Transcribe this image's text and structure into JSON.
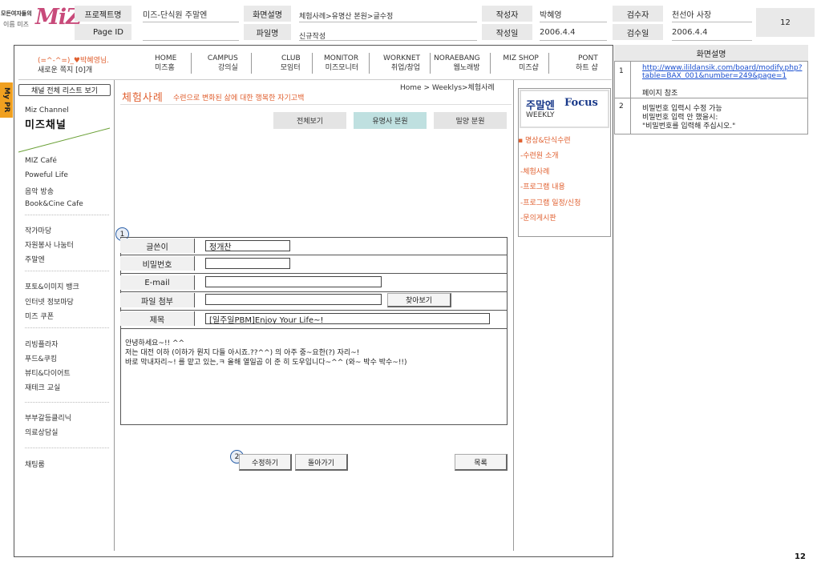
{
  "logo": {
    "line1": "모든여자들의",
    "line2": "이름 미즈",
    "mark": "MiZ"
  },
  "header": {
    "project_label": "프로젝트명",
    "project_value": "미즈-단식원 주말엔",
    "pageid_label": "Page ID",
    "pageid_value": "",
    "screen_label": "화면설명",
    "screen_value": "체험사례>유명산 본원>글수정",
    "file_label": "파일명",
    "file_value": "신규작성",
    "author_label": "작성자",
    "author_value": "박혜영",
    "date_label": "작성일",
    "date_value": "2006.4.4",
    "reviewer_label": "검수자",
    "reviewer_value": "천선아 사장",
    "review_date_label": "검수일",
    "review_date_value": "2006.4.4",
    "page_number": "12"
  },
  "user": {
    "greeting": "(=^-^=)_♥박혜영님.",
    "messages": "새로운 쪽지 [0]개"
  },
  "nav": [
    {
      "l1": "HOME",
      "l2": "미즈홈"
    },
    {
      "l1": "CAMPUS",
      "l2": "강의실"
    },
    {
      "l1": "CLUB",
      "l2": "모임터"
    },
    {
      "l1": "MONITOR",
      "l2": "미즈모니터"
    },
    {
      "l1": "WORKNET",
      "l2": "취업/창업"
    },
    {
      "l1": "NORAEBANG",
      "l2": "웹노래방"
    },
    {
      "l1": "MIZ SHOP",
      "l2": "미즈샵"
    },
    {
      "l1": "PONT",
      "l2": "하트 샵"
    }
  ],
  "mypr": "My PR",
  "sidebar": {
    "channel_list_btn": "채널 전체 리스트 보기",
    "channel_small": "Miz Channel",
    "channel_big": "미즈채널",
    "groups": [
      [
        "MIZ Café",
        "Poweful Life",
        "음악 방송",
        "Book&Cine Cafe"
      ],
      [
        "작가마당",
        "자원봉사 나눔터",
        "주말엔"
      ],
      [
        "포토&이미지 뱅크",
        "인터넷 정보마당",
        "미즈 쿠폰"
      ],
      [
        "리빙플라자",
        "푸드&쿠킹",
        "뷰티&다이어트",
        "재테크 교실"
      ],
      [
        "부부갈등클리닉",
        "의료상담실"
      ],
      [
        "채팅룸"
      ]
    ]
  },
  "content": {
    "breadcrumb": "Home > Weeklys>체험사례",
    "title": "체험사례",
    "subtitle": "수련으로 변화된 삶에 대한 행복한 자기고백",
    "tabs": [
      "전체보기",
      "유명사 본원",
      "밀양 분원"
    ],
    "form": {
      "author_label": "글쓴이",
      "author_value": "정개찬",
      "password_label": "비밀번호",
      "password_value": "",
      "email_label": "E-mail",
      "email_value": "",
      "file_label": "파일 첨부",
      "file_value": "",
      "browse_btn": "찾아보기",
      "subject_label": "제목",
      "subject_value": "[일주일PBM]Enjoy Your Life~!"
    },
    "body_lines": [
      "안녕하세요~!! ^^",
      "저는 대전 이하 (이하가 뭔지 다들 아시죠.??^^) 의 아주 중~요한(?) 자리~!",
      "바로 막내자리~! 를 맡고 있는,ㅋ 올해 열일곱 이 준 히 도우입니다~^^ (와~ 박수 박수~!!)"
    ],
    "edit_btn": "수정하기",
    "back_btn": "돌아가기",
    "list_btn": "목록"
  },
  "focus": {
    "title_kr": "주말엔",
    "title_en": "Focus",
    "weekly": "WEEKLY",
    "links": [
      "▪ 명상&단식수련",
      "-수련원 소개",
      "-체험사례",
      "-프로그램 내용",
      "-프로그램 일정/신청",
      "-문의게시판"
    ]
  },
  "annotations": {
    "one": "1",
    "two": "2"
  },
  "description": {
    "title": "화면설명",
    "rows": [
      {
        "num": "1",
        "link": "http://www.ilildansik.com/board/modify.php?table=BAX_001&number=249&page=1",
        "text": "페이지 참조"
      },
      {
        "num": "2",
        "lines": [
          "비밀번호 입력시 수정 가능",
          "비밀번호 입력 안 했을시:",
          "\"비밀번호를 입력해 주십시오.\""
        ]
      }
    ]
  },
  "footer_page": "12",
  "colors": {
    "accent_orange": "#e06030",
    "mypr_bg": "#f0a020",
    "focus_blue": "#1a3a8a",
    "link_blue": "#1a4fd0"
  }
}
